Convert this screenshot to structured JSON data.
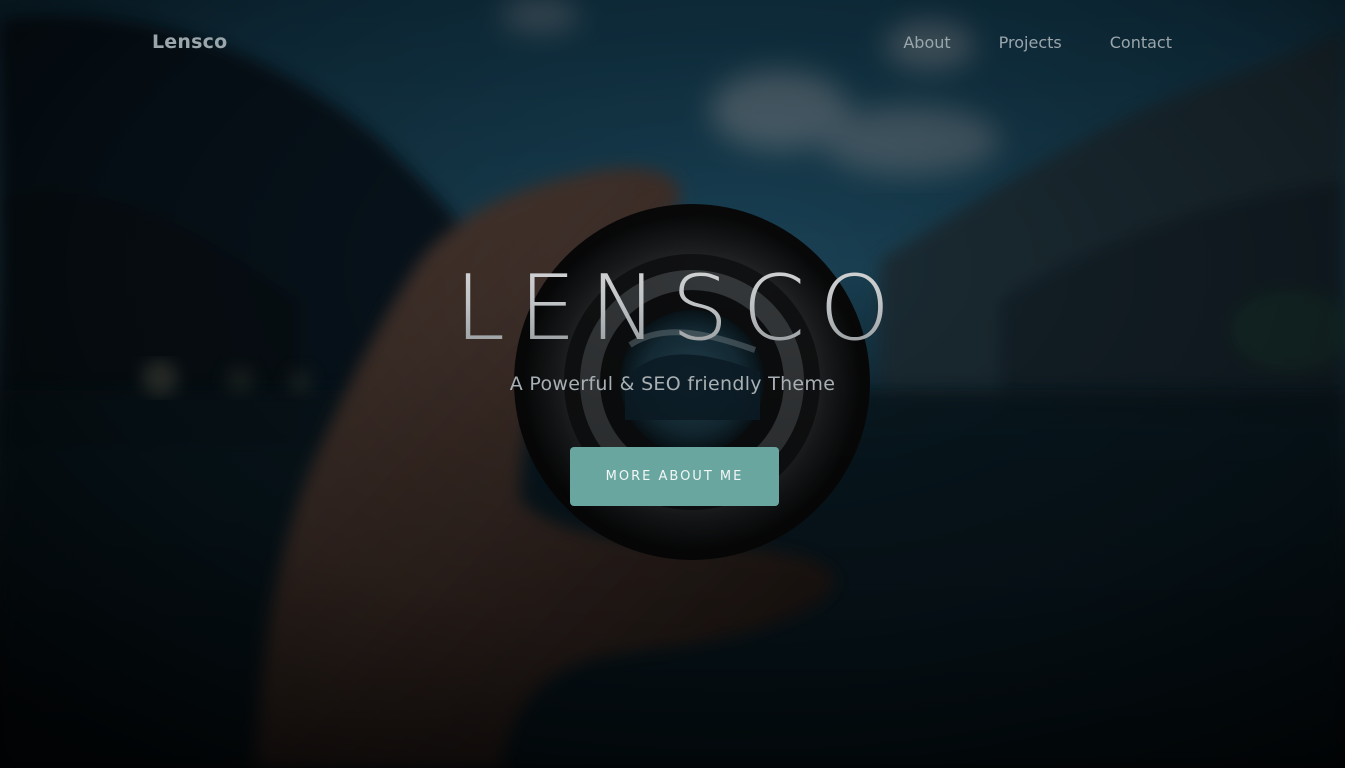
{
  "nav": {
    "brand": "Lensco",
    "links": [
      {
        "label": "About"
      },
      {
        "label": "Projects"
      },
      {
        "label": "Contact"
      }
    ]
  },
  "hero": {
    "title": "LENSCO",
    "subtitle": "A Powerful & SEO friendly Theme",
    "cta_label": "MORE ABOUT ME"
  },
  "colors": {
    "accent": "#6aa6a0",
    "nav_text": "#9aa6ab",
    "background_dark": "#05121a"
  },
  "background": {
    "description_icon": "camera-lens-photo"
  }
}
